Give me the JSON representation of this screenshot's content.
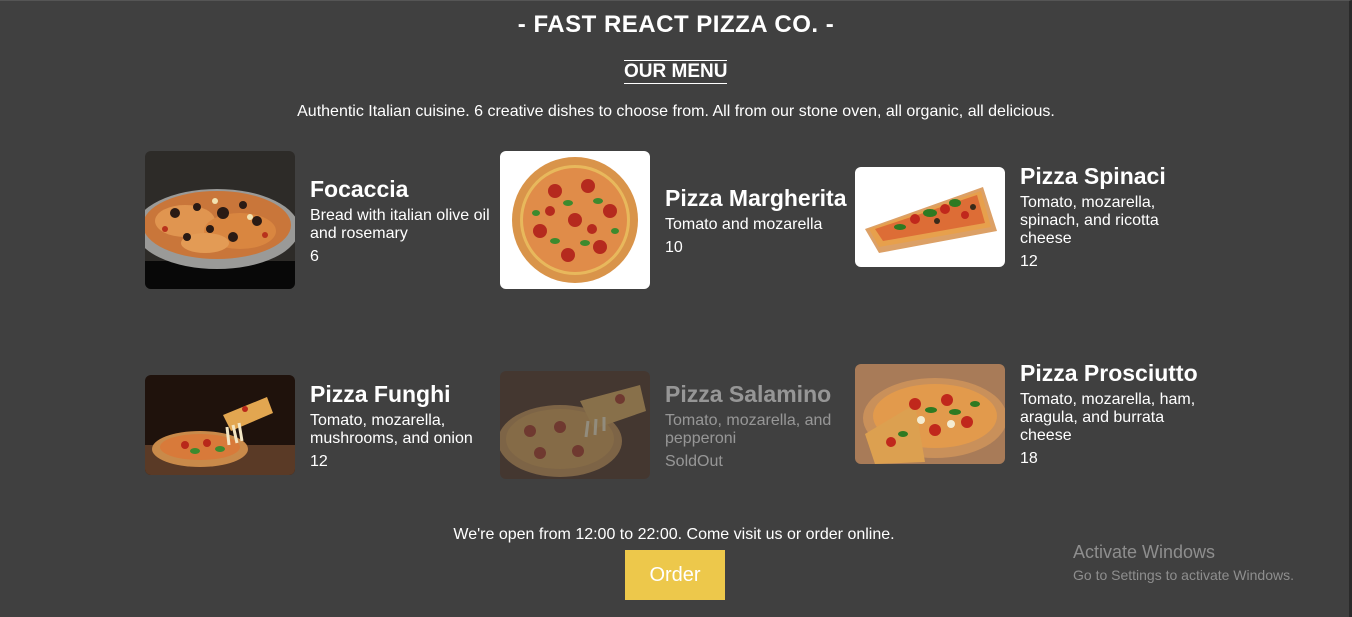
{
  "header": {
    "title": "- FAST REACT PIZZA CO. -"
  },
  "menu": {
    "title": "OUR MENU",
    "intro": "Authentic Italian cuisine. 6 creative dishes to choose from. All from our stone oven, all organic, all delicious.",
    "pizzas": [
      {
        "name": "Focaccia",
        "ingredients": "Bread with italian olive oil and rosemary",
        "price": "6",
        "image": "focaccia-photo"
      },
      {
        "name": "Pizza Margherita",
        "ingredients": "Tomato and mozarella",
        "price": "10",
        "image": "margherita-photo"
      },
      {
        "name": "Pizza Spinaci",
        "ingredients": "Tomato, mozarella, spinach, and ricotta cheese",
        "price": "12",
        "image": "spinaci-photo"
      },
      {
        "name": "Pizza Funghi",
        "ingredients": "Tomato, mozarella, mushrooms, and onion",
        "price": "12",
        "image": "funghi-photo"
      },
      {
        "name": "Pizza Salamino",
        "ingredients": "Tomato, mozarella, and pepperoni",
        "price": "SoldOut",
        "image": "salamino-photo"
      },
      {
        "name": "Pizza Prosciutto",
        "ingredients": "Tomato, mozarella, ham, aragula, and burrata cheese",
        "price": "18",
        "image": "prosciutto-photo"
      }
    ]
  },
  "footer": {
    "text": "We're open from 12:00 to 22:00. Come visit us or order online.",
    "order_label": "Order"
  },
  "watermark": {
    "title": "Activate Windows",
    "subtitle": "Go to Settings to activate Windows."
  },
  "colors": {
    "background": "#404040",
    "accent": "#edc84b",
    "text": "#ffffff"
  }
}
